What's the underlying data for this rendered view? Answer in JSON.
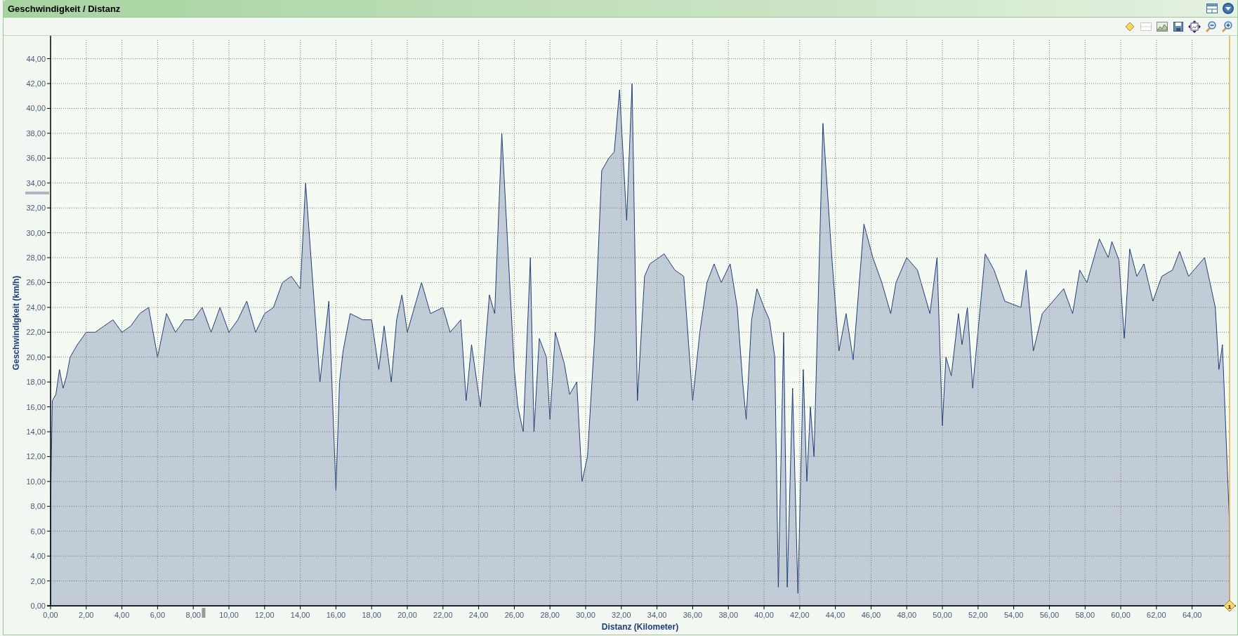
{
  "window": {
    "title": "Geschwindigkeit / Distanz"
  },
  "chart": {
    "marker": {
      "label": "1"
    },
    "chart_data": {
      "type": "area",
      "grid": true,
      "xlabel": "Distanz (Kilometer)",
      "ylabel": "Geschwindigkeit (km/h)",
      "xlim": [
        0,
        66.1
      ],
      "ylim": [
        0,
        45.5
      ],
      "xticks": [
        {
          "value": 0,
          "label": "0,00"
        },
        {
          "value": 2,
          "label": "2,00"
        },
        {
          "value": 4,
          "label": "4,00"
        },
        {
          "value": 6,
          "label": "6,00"
        },
        {
          "value": 8,
          "label": "8,00"
        },
        {
          "value": 10,
          "label": "10,00"
        },
        {
          "value": 12,
          "label": "12,00"
        },
        {
          "value": 14,
          "label": "14,00"
        },
        {
          "value": 16,
          "label": "16,00"
        },
        {
          "value": 18,
          "label": "18,00"
        },
        {
          "value": 20,
          "label": "20,00"
        },
        {
          "value": 22,
          "label": "22,00"
        },
        {
          "value": 24,
          "label": "24,00"
        },
        {
          "value": 26,
          "label": "26,00"
        },
        {
          "value": 28,
          "label": "28,00"
        },
        {
          "value": 30,
          "label": "30,00"
        },
        {
          "value": 32,
          "label": "32,00"
        },
        {
          "value": 34,
          "label": "34,00"
        },
        {
          "value": 36,
          "label": "36,00"
        },
        {
          "value": 38,
          "label": "38,00"
        },
        {
          "value": 40,
          "label": "40,00"
        },
        {
          "value": 42,
          "label": "42,00"
        },
        {
          "value": 44,
          "label": "44,00"
        },
        {
          "value": 46,
          "label": "46,00"
        },
        {
          "value": 48,
          "label": "48,00"
        },
        {
          "value": 50,
          "label": "50,00"
        },
        {
          "value": 52,
          "label": "52,00"
        },
        {
          "value": 54,
          "label": "54,00"
        },
        {
          "value": 56,
          "label": "56,00"
        },
        {
          "value": 58,
          "label": "58,00"
        },
        {
          "value": 60,
          "label": "60,00"
        },
        {
          "value": 62,
          "label": "62,00"
        },
        {
          "value": 64,
          "label": "64,00"
        }
      ],
      "yticks": [
        {
          "value": 0,
          "label": "0,00"
        },
        {
          "value": 2,
          "label": "2,00"
        },
        {
          "value": 4,
          "label": "4,00"
        },
        {
          "value": 6,
          "label": "6,00"
        },
        {
          "value": 8,
          "label": "8,00"
        },
        {
          "value": 10,
          "label": "10,00"
        },
        {
          "value": 12,
          "label": "12,00"
        },
        {
          "value": 14,
          "label": "14,00"
        },
        {
          "value": 16,
          "label": "16,00"
        },
        {
          "value": 18,
          "label": "18,00"
        },
        {
          "value": 20,
          "label": "20,00"
        },
        {
          "value": 22,
          "label": "22,00"
        },
        {
          "value": 24,
          "label": "24,00"
        },
        {
          "value": 26,
          "label": "26,00"
        },
        {
          "value": 28,
          "label": "28,00"
        },
        {
          "value": 30,
          "label": "30,00"
        },
        {
          "value": 32,
          "label": "32,00"
        },
        {
          "value": 34,
          "label": "34,00"
        },
        {
          "value": 36,
          "label": "36,00"
        },
        {
          "value": 38,
          "label": "38,00"
        },
        {
          "value": 40,
          "label": "40,00"
        },
        {
          "value": 42,
          "label": "42,00"
        },
        {
          "value": 44,
          "label": "44,00"
        }
      ],
      "x": [
        0,
        0.1,
        0.3,
        0.5,
        0.7,
        0.9,
        1.1,
        1.5,
        2,
        2.5,
        3,
        3.5,
        4,
        4.5,
        5,
        5.5,
        6,
        6.5,
        7,
        7.5,
        8,
        8.5,
        9,
        9.5,
        10,
        10.5,
        11,
        11.5,
        12,
        12.5,
        13,
        13.5,
        14,
        14.3,
        14.7,
        15.1,
        15.6,
        16,
        16.2,
        16.4,
        16.8,
        17.5,
        18,
        18.4,
        18.7,
        19.1,
        19.4,
        19.7,
        20,
        20.8,
        21.3,
        22,
        22.4,
        23,
        23.3,
        23.6,
        24.1,
        24.6,
        24.9,
        25.3,
        26,
        26.2,
        26.5,
        26.9,
        27.1,
        27.4,
        27.8,
        28,
        28.3,
        28.8,
        29.1,
        29.5,
        29.8,
        30.1,
        30.5,
        30.9,
        31.3,
        31.6,
        31.9,
        32.3,
        32.6,
        32.9,
        33.3,
        33.6,
        34.4,
        35,
        35.5,
        36,
        36.4,
        36.8,
        37.2,
        37.6,
        38.1,
        38.5,
        38.8,
        39,
        39.3,
        39.6,
        40,
        40.3,
        40.6,
        40.8,
        41.1,
        41.3,
        41.6,
        41.9,
        42.2,
        42.4,
        42.6,
        42.8,
        43.3,
        43.8,
        44.2,
        44.6,
        45,
        45.6,
        46.1,
        46.6,
        47.1,
        47.4,
        48,
        48.6,
        49.3,
        49.7,
        50,
        50.2,
        50.5,
        50.9,
        51.1,
        51.4,
        51.7,
        52.4,
        52.9,
        53.5,
        54.4,
        54.7,
        55.1,
        55.6,
        56.2,
        56.8,
        57.3,
        57.7,
        58.1,
        58.8,
        59.3,
        59.5,
        59.9,
        60.2,
        60.5,
        60.9,
        61.3,
        61.8,
        62.3,
        62.9,
        63.3,
        63.8,
        64.7,
        65.3,
        65.5,
        65.7,
        66.1
      ],
      "series": [
        {
          "color": "#c1ccd6",
          "values": [
            8,
            16.5,
            17,
            19,
            17.5,
            18.5,
            20,
            21,
            22,
            22,
            22.5,
            23,
            22,
            22.5,
            23.5,
            24,
            20,
            23.5,
            22,
            23,
            23,
            24,
            22,
            24,
            22,
            23,
            24.5,
            22,
            23.5,
            24,
            26,
            26.5,
            25.5,
            34,
            26,
            18,
            24.5,
            9.3,
            18,
            20.5,
            23.5,
            23,
            23,
            19,
            22.5,
            18,
            23,
            25,
            22,
            26,
            23.5,
            24,
            22,
            23,
            16.5,
            21,
            16,
            25,
            23.5,
            38,
            19,
            16,
            14,
            28,
            14,
            21.5,
            20,
            15,
            22,
            19.5,
            17,
            18,
            10,
            12,
            21.5,
            35,
            36,
            36.5,
            41.5,
            31,
            42,
            16.5,
            26.5,
            27.5,
            28.3,
            27,
            26.5,
            16.5,
            22,
            26,
            27.5,
            26,
            27.5,
            24,
            18,
            15,
            23,
            25.5,
            24,
            23,
            20,
            1.5,
            22,
            1.5,
            17.5,
            1,
            19,
            10,
            16,
            12,
            38.8,
            28,
            20.5,
            23.5,
            19.8,
            30.7,
            28,
            26,
            23.5,
            26,
            28,
            27,
            23.5,
            28,
            14.5,
            20,
            18.5,
            23.5,
            21,
            24,
            17.5,
            28.3,
            27,
            24.5,
            24,
            27,
            20.5,
            23.5,
            24.5,
            25.5,
            23.5,
            27,
            26,
            29.5,
            28,
            29.3,
            27.8,
            21.5,
            28.7,
            26.5,
            27.5,
            24.5,
            26.5,
            27,
            28.5,
            26.5,
            28,
            24,
            19,
            21,
            6.5
          ]
        }
      ]
    }
  }
}
